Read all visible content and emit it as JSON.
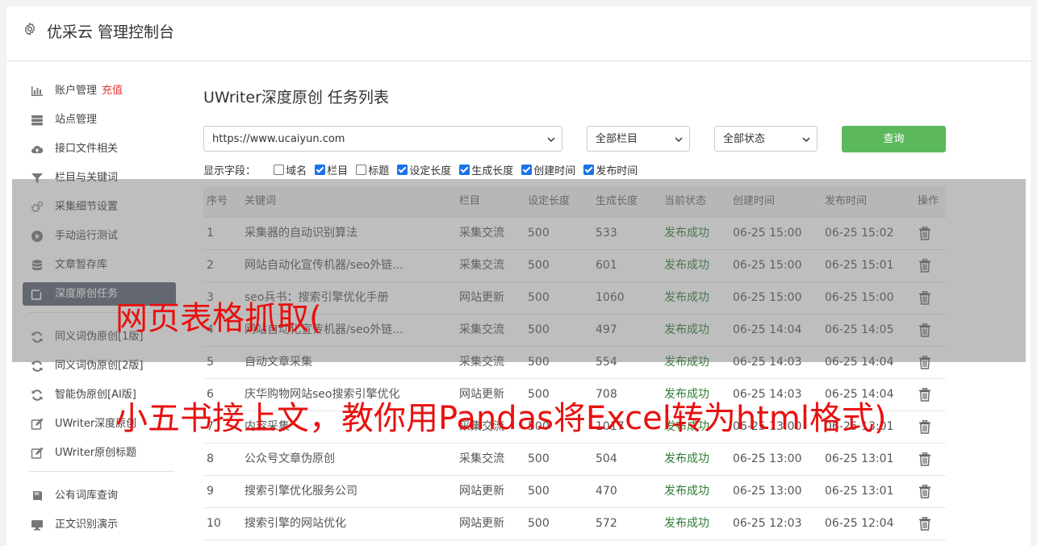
{
  "header": {
    "title": "优采云 管理控制台"
  },
  "sidebar": {
    "group1": [
      {
        "label": "账户管理",
        "tag": "充值",
        "icon": "bar-chart-icon"
      },
      {
        "label": "站点管理",
        "icon": "server-icon"
      },
      {
        "label": "接口文件相关",
        "icon": "cloud-upload-icon"
      },
      {
        "label": "栏目与关键词",
        "icon": "filter-icon"
      },
      {
        "label": "采集细节设置",
        "icon": "gears-icon"
      },
      {
        "label": "手动运行测试",
        "icon": "play-circle-icon"
      },
      {
        "label": "文章暂存库",
        "icon": "database-icon"
      },
      {
        "label": "深度原创任务",
        "icon": "edit-icon",
        "active": true
      }
    ],
    "group2": [
      {
        "label": "同义词伪原创[1版]",
        "icon": "refresh-icon"
      },
      {
        "label": "同义词伪原创[2版]",
        "icon": "refresh-icon"
      },
      {
        "label": "智能伪原创[AI版]",
        "icon": "refresh-icon"
      },
      {
        "label": "UWriter深度原创",
        "icon": "edit-icon"
      },
      {
        "label": "UWriter原创标题",
        "icon": "edit-icon"
      }
    ],
    "group3": [
      {
        "label": "公有词库查询",
        "icon": "book-icon"
      },
      {
        "label": "正文识别演示",
        "icon": "monitor-icon"
      }
    ]
  },
  "main": {
    "title": "UWriter深度原创 任务列表",
    "site_select": "https://www.ucaiyun.com",
    "column_select": "全部栏目",
    "status_select": "全部状态",
    "query_label": "查询",
    "fields_label": "显示字段：",
    "fields": [
      {
        "label": "域名",
        "checked": false
      },
      {
        "label": "栏目",
        "checked": true
      },
      {
        "label": "标题",
        "checked": false
      },
      {
        "label": "设定长度",
        "checked": true
      },
      {
        "label": "生成长度",
        "checked": true
      },
      {
        "label": "创建时间",
        "checked": true
      },
      {
        "label": "发布时间",
        "checked": true
      }
    ]
  },
  "table": {
    "headers": [
      "序号",
      "关键词",
      "栏目",
      "设定长度",
      "生成长度",
      "当前状态",
      "创建时间",
      "发布时间",
      "操作"
    ],
    "rows": [
      [
        "1",
        "采集器的自动识别算法",
        "采集交流",
        "500",
        "533",
        "发布成功",
        "06-25 15:00",
        "06-25 15:02"
      ],
      [
        "2",
        "网站自动化宣传机器/seo外链...",
        "采集交流",
        "500",
        "601",
        "发布成功",
        "06-25 15:00",
        "06-25 15:01"
      ],
      [
        "3",
        "seo兵书：搜索引擎优化手册",
        "网站更新",
        "500",
        "1060",
        "发布成功",
        "06-25 15:00",
        "06-25 15:00"
      ],
      [
        "4",
        "网站自动化宣传机器/seo外链...",
        "采集交流",
        "500",
        "497",
        "发布成功",
        "06-25 14:04",
        "06-25 14:05"
      ],
      [
        "5",
        "自动文章采集",
        "采集交流",
        "500",
        "554",
        "发布成功",
        "06-25 14:03",
        "06-25 14:04"
      ],
      [
        "6",
        "庆华购物网站seo搜索引擎优化",
        "网站更新",
        "500",
        "708",
        "发布成功",
        "06-25 14:03",
        "06-25 14:04"
      ],
      [
        "7",
        "内容采集",
        "采集交流",
        "500",
        "1017",
        "发布成功",
        "06-25 13:00",
        "06-25 13:01"
      ],
      [
        "8",
        "公众号文章伪原创",
        "采集交流",
        "500",
        "504",
        "发布成功",
        "06-25 13:00",
        "06-25 13:01"
      ],
      [
        "9",
        "搜索引擎优化服务公司",
        "网站更新",
        "500",
        "470",
        "发布成功",
        "06-25 13:00",
        "06-25 13:01"
      ],
      [
        "10",
        "搜索引擎的网站优化",
        "网站更新",
        "500",
        "572",
        "发布成功",
        "06-25 12:03",
        "06-25 12:04"
      ]
    ]
  },
  "overlay": {
    "line1": "网页表格抓取(",
    "line2": "小五书接上文，教你用Pandas将Excel转为html格式)"
  }
}
